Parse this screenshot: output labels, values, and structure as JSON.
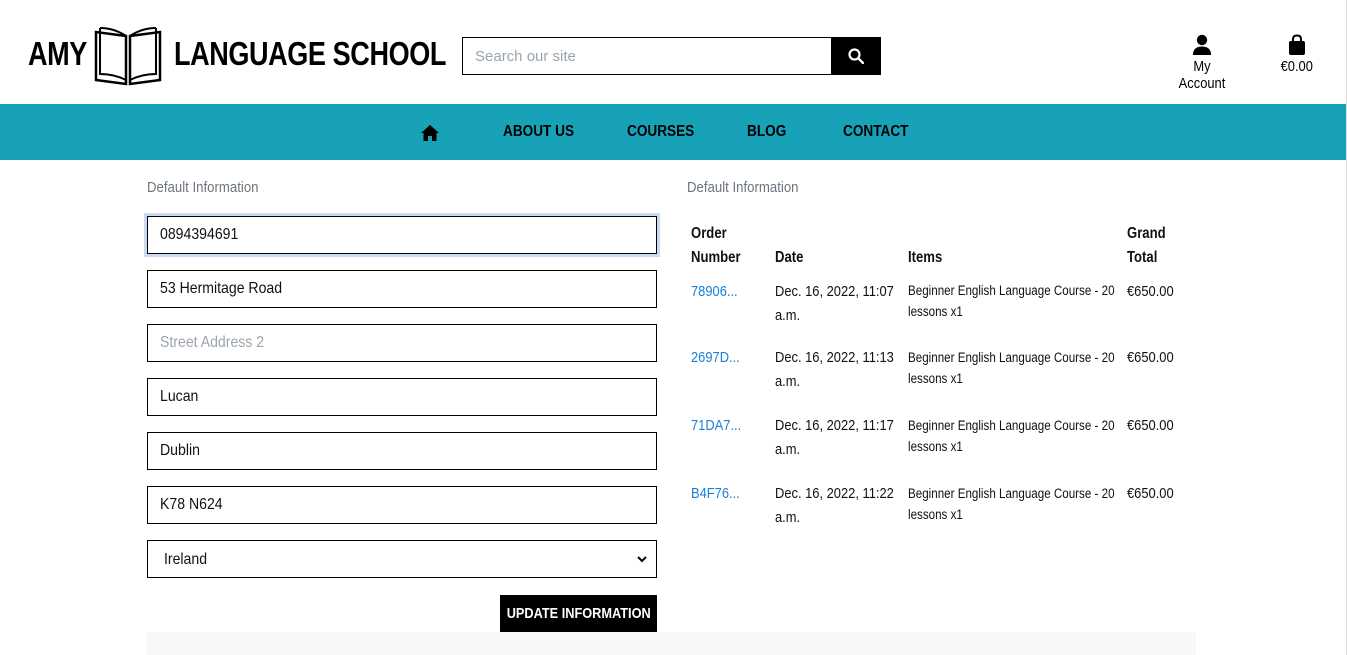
{
  "header": {
    "logo_left": "AMY",
    "logo_right": "LANGUAGE SCHOOL",
    "search_placeholder": "Search our site",
    "account_label": "My Account",
    "bag_total": "€0.00"
  },
  "nav": {
    "items": [
      "ABOUT US",
      "COURSES",
      "BLOG",
      "CONTACT"
    ]
  },
  "form": {
    "heading": "Default Information",
    "phone": "0894394691",
    "street1": "53 Hermitage Road",
    "street2_placeholder": "Street Address 2",
    "town": "Lucan",
    "county": "Dublin",
    "postcode": "K78 N624",
    "country": "Ireland",
    "update_label": "UPDATE INFORMATION"
  },
  "orders": {
    "heading": "Default Information",
    "headers": {
      "order_number_1": "Order",
      "order_number_2": "Number",
      "date": "Date",
      "items": "Items",
      "total_1": "Grand",
      "total_2": "Total"
    },
    "rows": [
      {
        "number": "78906...",
        "date_1": "Dec. 16, 2022, 11:07",
        "date_2": "a.m.",
        "items_1": "Beginner English Language Course - 20",
        "items_2": "lessons x1",
        "total": "€650.00"
      },
      {
        "number": "2697D...",
        "date_1": "Dec. 16, 2022, 11:13",
        "date_2": "a.m.",
        "items_1": "Beginner English Language Course - 20",
        "items_2": "lessons x1",
        "total": "€650.00"
      },
      {
        "number": "71DA7...",
        "date_1": "Dec. 16, 2022, 11:17",
        "date_2": "a.m.",
        "items_1": "Beginner English Language Course - 20",
        "items_2": "lessons x1",
        "total": "€650.00"
      },
      {
        "number": "B4F76...",
        "date_1": "Dec. 16, 2022, 11:22",
        "date_2": "a.m.",
        "items_1": "Beginner English Language Course - 20",
        "items_2": "lessons x1",
        "total": "€650.00"
      }
    ]
  },
  "colors": {
    "nav_bg": "#17a2b8",
    "link": "#1a7fd6"
  }
}
